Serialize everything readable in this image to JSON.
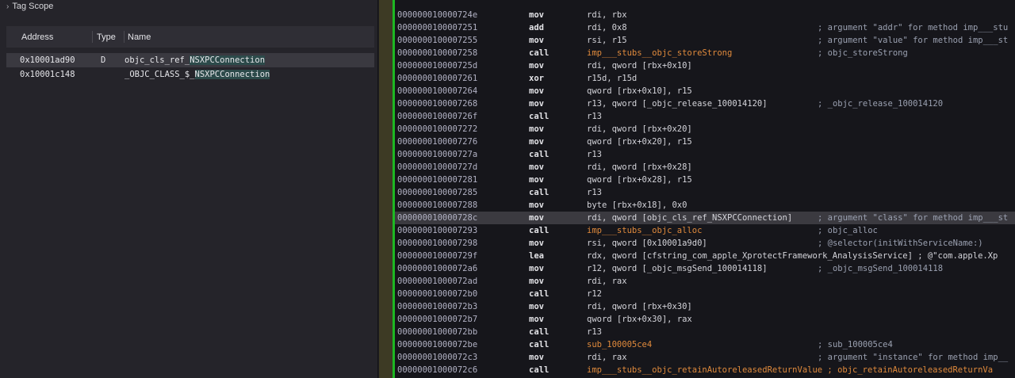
{
  "left_panel": {
    "scope_title": "Tag Scope",
    "columns": {
      "address": "Address",
      "type": "Type",
      "name": "Name"
    },
    "rows": [
      {
        "address": "0x10001ad90",
        "type": "D",
        "name_prefix": "objc_cls_ref_",
        "name_hl": "NSXPCConnection",
        "selected": true
      },
      {
        "address": "0x10001c148",
        "type": "",
        "name_prefix": "_OBJC_CLASS_$_",
        "name_hl": "NSXPCConnection",
        "selected": false
      }
    ]
  },
  "disassembly": {
    "lines": [
      {
        "addr": "000000010000724e",
        "mn": "mov",
        "ops": "rdi, rbx",
        "cmt": ""
      },
      {
        "addr": "0000000100007251",
        "mn": "add",
        "ops": "rdi, 0x8",
        "cmt": "; argument \"addr\" for method imp___stu"
      },
      {
        "addr": "0000000100007255",
        "mn": "mov",
        "ops": "rsi, r15",
        "cmt": "; argument \"value\" for method imp___st"
      },
      {
        "addr": "0000000100007258",
        "mn": "call",
        "ops": "imp___stubs__objc_storeStrong",
        "cmt": "; objc_storeStrong"
      },
      {
        "addr": "000000010000725d",
        "mn": "mov",
        "ops": "rdi, qword [rbx+0x10]",
        "cmt": ""
      },
      {
        "addr": "0000000100007261",
        "mn": "xor",
        "ops": "r15d, r15d",
        "cmt": ""
      },
      {
        "addr": "0000000100007264",
        "mn": "mov",
        "ops": "qword [rbx+0x10], r15",
        "cmt": ""
      },
      {
        "addr": "0000000100007268",
        "mn": "mov",
        "ops": "r13, qword [_objc_release_100014120]",
        "cmt": "; _objc_release_100014120"
      },
      {
        "addr": "000000010000726f",
        "mn": "call",
        "ops": "r13",
        "cmt": ""
      },
      {
        "addr": "0000000100007272",
        "mn": "mov",
        "ops": "rdi, qword [rbx+0x20]",
        "cmt": ""
      },
      {
        "addr": "0000000100007276",
        "mn": "mov",
        "ops": "qword [rbx+0x20], r15",
        "cmt": ""
      },
      {
        "addr": "000000010000727a",
        "mn": "call",
        "ops": "r13",
        "cmt": ""
      },
      {
        "addr": "000000010000727d",
        "mn": "mov",
        "ops": "rdi, qword [rbx+0x28]",
        "cmt": ""
      },
      {
        "addr": "0000000100007281",
        "mn": "mov",
        "ops": "qword [rbx+0x28], r15",
        "cmt": ""
      },
      {
        "addr": "0000000100007285",
        "mn": "call",
        "ops": "r13",
        "cmt": ""
      },
      {
        "addr": "0000000100007288",
        "mn": "mov",
        "ops": "byte [rbx+0x18], 0x0",
        "cmt": ""
      },
      {
        "addr": "000000010000728c",
        "mn": "mov",
        "ops": "rdi, qword [objc_cls_ref_NSXPCConnection]",
        "cmt": "; argument \"class\" for method imp___st",
        "current": true
      },
      {
        "addr": "0000000100007293",
        "mn": "call",
        "ops": "imp___stubs__objc_alloc",
        "cmt": "; objc_alloc"
      },
      {
        "addr": "0000000100007298",
        "mn": "mov",
        "ops": "rsi, qword [0x10001a9d0]",
        "cmt": "; @selector(initWithServiceName:)"
      },
      {
        "addr": "000000010000729f",
        "mn": "lea",
        "ops": "rdx, qword [cfstring_com_apple_XprotectFramework_AnalysisService] ; @\"com.apple.Xp",
        "cmt": ""
      },
      {
        "addr": "00000001000072a6",
        "mn": "mov",
        "ops": "r12, qword [_objc_msgSend_100014118]",
        "cmt": "; _objc_msgSend_100014118"
      },
      {
        "addr": "00000001000072ad",
        "mn": "mov",
        "ops": "rdi, rax",
        "cmt": ""
      },
      {
        "addr": "00000001000072b0",
        "mn": "call",
        "ops": "r12",
        "cmt": ""
      },
      {
        "addr": "00000001000072b3",
        "mn": "mov",
        "ops": "rdi, qword [rbx+0x30]",
        "cmt": ""
      },
      {
        "addr": "00000001000072b7",
        "mn": "mov",
        "ops": "qword [rbx+0x30], rax",
        "cmt": ""
      },
      {
        "addr": "00000001000072bb",
        "mn": "call",
        "ops": "r13",
        "cmt": ""
      },
      {
        "addr": "00000001000072be",
        "mn": "call",
        "ops": "sub_100005ce4",
        "cmt": "; sub_100005ce4"
      },
      {
        "addr": "00000001000072c3",
        "mn": "mov",
        "ops": "rdi, rax",
        "cmt": "; argument \"instance\" for method imp__"
      },
      {
        "addr": "00000001000072c6",
        "mn": "call",
        "ops": "imp___stubs__objc_retainAutoreleasedReturnValue ; objc_retainAutoreleasedReturnVa",
        "cmt": ""
      }
    ]
  }
}
